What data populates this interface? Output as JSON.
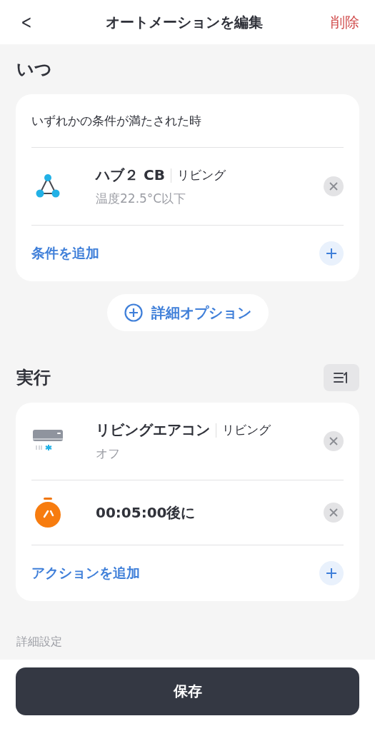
{
  "header": {
    "back": "<",
    "title": "オートメーションを編集",
    "delete": "削除"
  },
  "when": {
    "title": "いつ",
    "condition_mode": "いずれかの条件が満たされた時",
    "items": [
      {
        "kind": "hub",
        "name": "ハブ２ CB",
        "room": "リビング",
        "status": "温度22.5°C以下"
      }
    ],
    "add": "条件を追加"
  },
  "advanced_options": "詳細オプション",
  "run": {
    "title": "実行",
    "items": [
      {
        "kind": "aircon",
        "name": "リビングエアコン",
        "room": "リビング",
        "status": "オフ"
      },
      {
        "kind": "timer",
        "name": "00:05:00後に"
      }
    ],
    "add": "アクションを追加"
  },
  "advanced_settings": "詳細設定",
  "save": "保存"
}
